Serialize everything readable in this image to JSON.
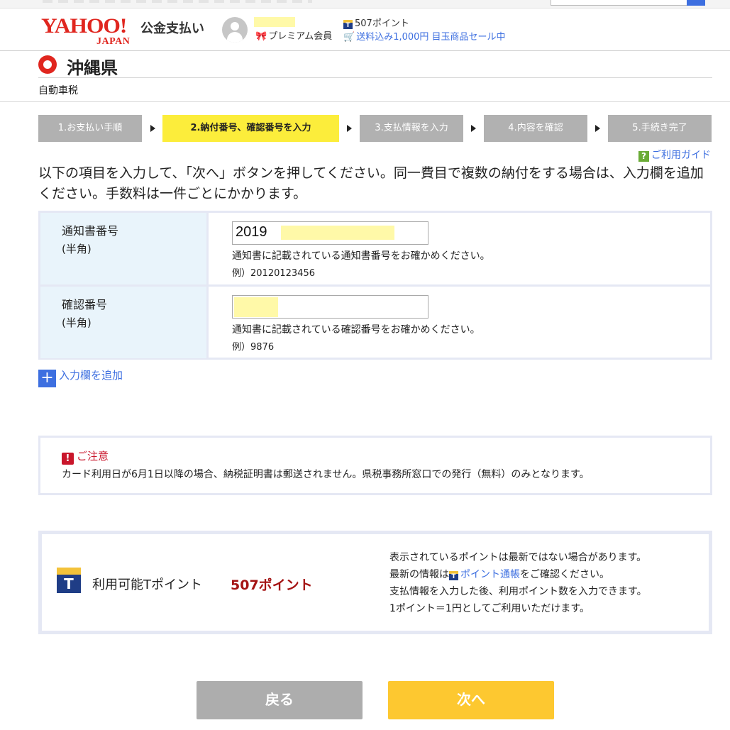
{
  "header": {
    "logo_main": "YAHOO!",
    "logo_sub": "JAPAN",
    "service_name": "公金支払い",
    "membership": "プレミアム会員",
    "points": "507ポイント",
    "sale_link": "送料込み1,000円 目玉商品セール中"
  },
  "prefecture": {
    "name": "沖縄県",
    "tax_type": "自動車税"
  },
  "steps": [
    {
      "label": "1.お支払い手順",
      "active": false
    },
    {
      "label": "2.納付番号、確認番号を入力",
      "active": true
    },
    {
      "label": "3.支払情報を入力",
      "active": false
    },
    {
      "label": "4.内容を確認",
      "active": false
    },
    {
      "label": "5.手続き完了",
      "active": false
    }
  ],
  "guide_link": "ご利用ガイド",
  "instructions": "以下の項目を入力して、「次へ」ボタンを押してください。同一費目で複数の納付をする場合は、入力欄を追加ください。手数料は一件ごとにかかります。",
  "form": {
    "notice_number": {
      "label": "通知書番号",
      "sublabel": "(半角)",
      "value": "2019",
      "help": "通知書に記載されている通知書番号をお確かめください。",
      "example": "例）20120123456"
    },
    "confirm_number": {
      "label": "確認番号",
      "sublabel": "(半角)",
      "value": "",
      "help": "通知書に記載されている確認番号をお確かめください。",
      "example": "例）9876"
    },
    "add_field": "入力欄を追加"
  },
  "caution": {
    "title": "ご注意",
    "text": "カード利用日が6月1日以降の場合、納税証明書は郵送されません。県税事務所窓口での発行（無料）のみとなります。"
  },
  "tpoint": {
    "label": "利用可能Tポイント",
    "value": "507ポイント",
    "note1": "表示されているポイントは最新ではない場合があります。",
    "note2_prefix": "最新の情報は",
    "note2_link": "ポイント通帳",
    "note2_suffix": "をご確認ください。",
    "note3": "支払情報を入力した後、利用ポイント数を入力できます。",
    "note4": "1ポイント＝1円としてご利用いただけます。"
  },
  "buttons": {
    "back": "戻る",
    "next": "次へ"
  },
  "colors": {
    "brand_red": "#e0261f",
    "active_step": "#fced3b",
    "inactive_step": "#b1b1b1",
    "link_blue": "#3d6fe0",
    "next_button": "#fdc830",
    "back_button": "#adadad",
    "points_value": "#a41414",
    "caution_red": "#c9162b"
  }
}
